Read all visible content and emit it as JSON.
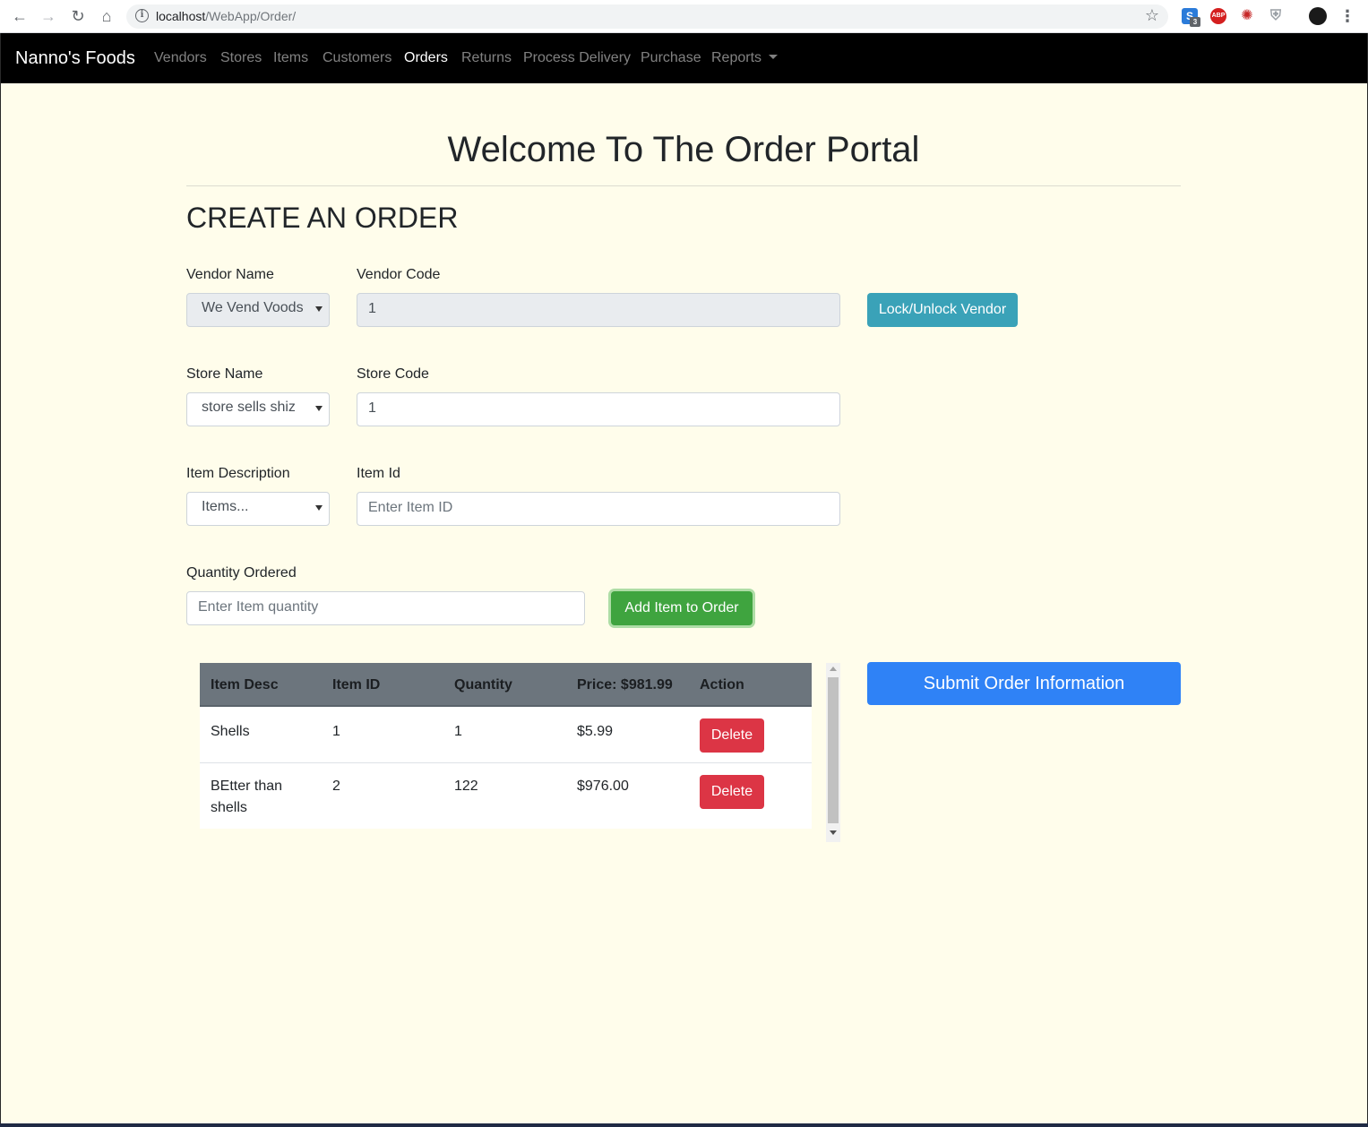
{
  "browser": {
    "url_host": "localhost",
    "url_path": "/WebApp/Order/",
    "extension_badge": "3",
    "abp_label": "ABP",
    "s_label": "S"
  },
  "navbar": {
    "brand": "Nanno's Foods",
    "links": [
      {
        "label": "Vendors",
        "active": false
      },
      {
        "label": "Stores",
        "active": false
      },
      {
        "label": "Items",
        "active": false
      },
      {
        "label": "Customers",
        "active": false
      },
      {
        "label": "Orders",
        "active": true
      },
      {
        "label": "Returns",
        "active": false
      },
      {
        "label": "Process Delivery",
        "active": false
      },
      {
        "label": "Purchase",
        "active": false
      },
      {
        "label": "Reports",
        "active": false,
        "dropdown": true
      }
    ]
  },
  "page": {
    "title": "Welcome To The Order Portal",
    "section_title": "CREATE AN ORDER"
  },
  "form": {
    "vendor_name_label": "Vendor Name",
    "vendor_name_value": "We Vend Voods",
    "vendor_code_label": "Vendor Code",
    "vendor_code_value": "1",
    "lock_button": "Lock/Unlock Vendor",
    "store_name_label": "Store Name",
    "store_name_value": "store sells shiz",
    "store_code_label": "Store Code",
    "store_code_value": "1",
    "item_desc_label": "Item Description",
    "item_desc_value": "Items...",
    "item_id_label": "Item Id",
    "item_id_placeholder": "Enter Item ID",
    "quantity_label": "Quantity Ordered",
    "quantity_placeholder": "Enter Item quantity",
    "add_button": "Add Item to Order",
    "submit_button": "Submit Order Information"
  },
  "table": {
    "headers": [
      "Item Desc",
      "Item ID",
      "Quantity",
      "Price: $981.99",
      "Action"
    ],
    "rows": [
      {
        "desc": "Shells",
        "id": "1",
        "quantity": "1",
        "price": "$5.99",
        "action": "Delete"
      },
      {
        "desc": "BEtter than shells",
        "id": "2",
        "quantity": "122",
        "price": "$976.00",
        "action": "Delete"
      }
    ]
  },
  "colors": {
    "page_bg": "#fffdeb",
    "navbar_bg": "#000000",
    "info": "#3aa2b8",
    "success": "#3fa43f",
    "primary": "#2f82f6",
    "danger": "#dc3545",
    "table_head": "#6c757d"
  }
}
